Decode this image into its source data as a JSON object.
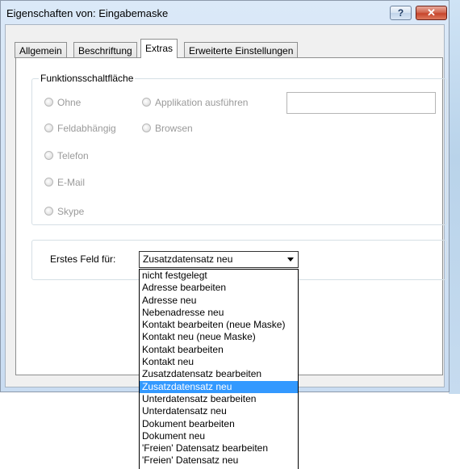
{
  "window": {
    "title": "Eigenschaften von: Eingabemaske",
    "help_glyph": "?",
    "close_glyph": "✕"
  },
  "tabs": [
    {
      "label": "Allgemein"
    },
    {
      "label": "Beschriftung"
    },
    {
      "label": "Extras",
      "active": true
    },
    {
      "label": "Erweiterte Einstellungen"
    }
  ],
  "function_group": {
    "legend": "Funktionsschaltfläche",
    "options_left": [
      "Ohne",
      "Feldabhängig",
      "Telefon",
      "E-Mail",
      "Skype"
    ],
    "options_right": [
      "Applikation ausführen",
      "Browsen"
    ],
    "textbox_value": ""
  },
  "first_field": {
    "label": "Erstes Feld für:",
    "selected": "Zusatzdatensatz neu",
    "options": [
      "nicht festgelegt",
      "Adresse bearbeiten",
      "Adresse neu",
      "Nebenadresse neu",
      "Kontakt bearbeiten (neue Maske)",
      "Kontakt neu (neue Maske)",
      "Kontakt bearbeiten",
      "Kontakt neu",
      "Zusatzdatensatz bearbeiten",
      "Zusatzdatensatz neu",
      "Unterdatensatz bearbeiten",
      "Unterdatensatz neu",
      "Dokument bearbeiten",
      "Dokument neu",
      "'Freien' Datensatz bearbeiten",
      "'Freien' Datensatz neu"
    ]
  },
  "colors": {
    "selection": "#3399ff",
    "disabled_text": "#9a9a9a"
  }
}
